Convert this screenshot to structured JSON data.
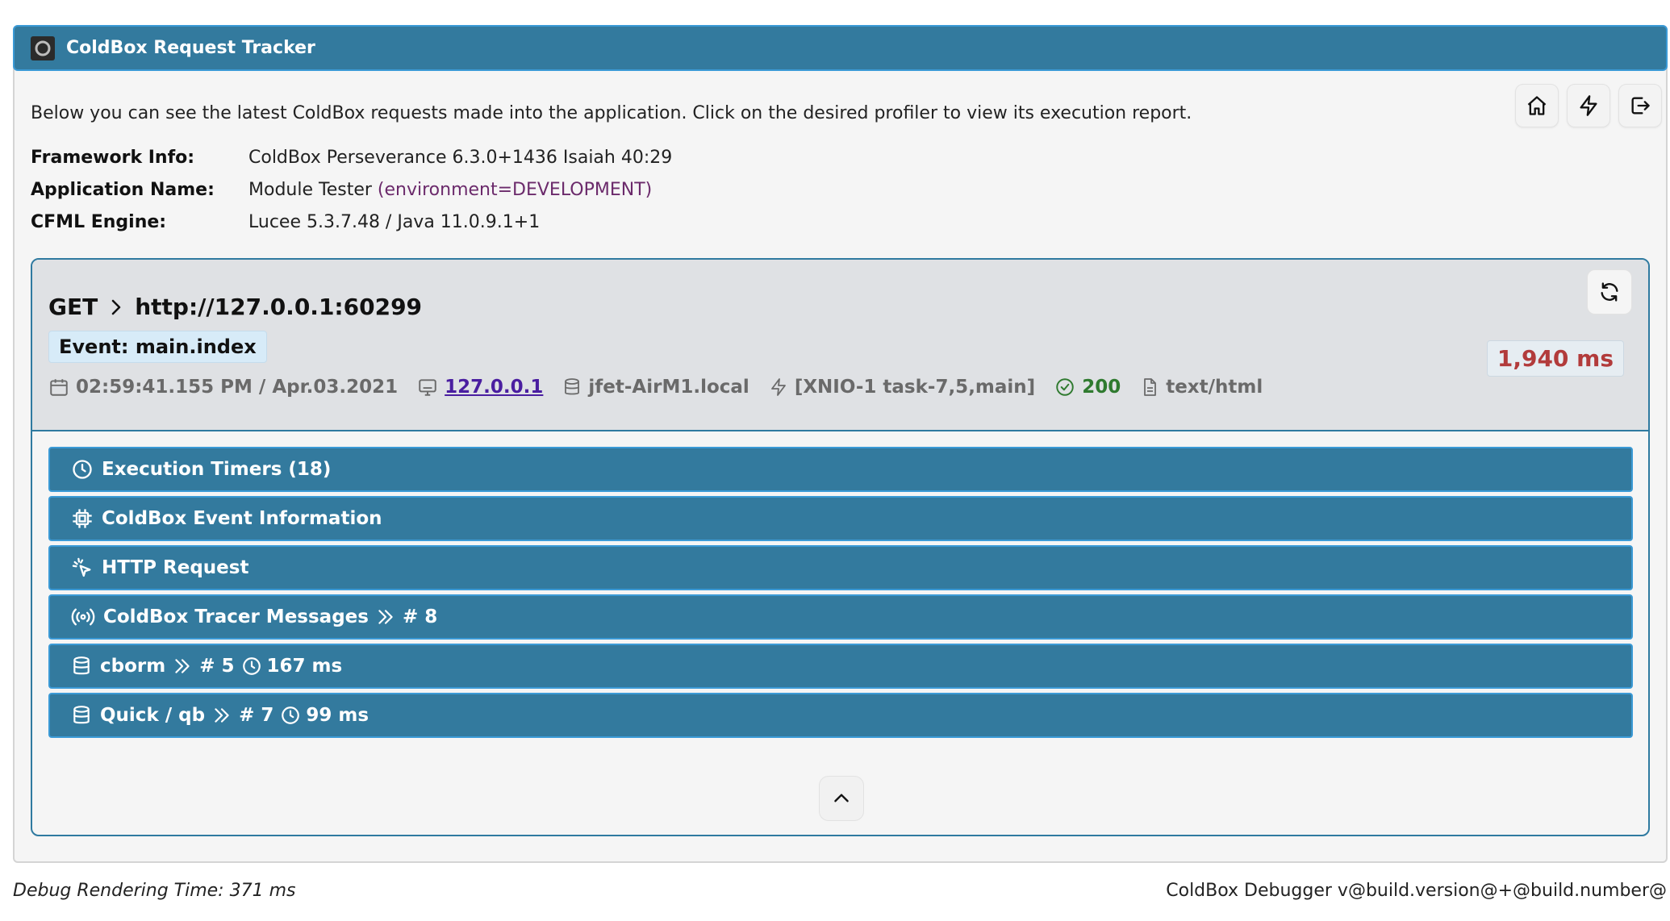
{
  "header": {
    "title": "ColdBox Request Tracker"
  },
  "intro": "Below you can see the latest ColdBox requests made into the application. Click on the desired profiler to view its execution report.",
  "info": [
    {
      "label": "Framework Info:",
      "value": "ColdBox Perseverance 6.3.0+1436 Isaiah 40:29",
      "extra": ""
    },
    {
      "label": "Application Name:",
      "value": "Module Tester",
      "extra": "(environment=DEVELOPMENT)"
    },
    {
      "label": "CFML Engine:",
      "value": "Lucee 5.3.7.48 / Java 11.0.9.1+1",
      "extra": ""
    }
  ],
  "request": {
    "method": "GET",
    "url": "http://127.0.0.1:60299",
    "event": "Event: main.index",
    "duration": "1,940 ms",
    "timestamp": "02:59:41.155 PM / Apr.03.2021",
    "ip": "127.0.0.1",
    "host": "jfet-AirM1.local",
    "thread": "[XNIO-1 task-7,5,main]",
    "status": "200",
    "content_type": "text/html"
  },
  "sections": [
    {
      "label": "Execution Timers (18)"
    },
    {
      "label": "ColdBox Event Information"
    },
    {
      "label": "HTTP Request"
    },
    {
      "label": "ColdBox Tracer Messages",
      "count": "# 8"
    },
    {
      "label": "cborm",
      "count": "# 5",
      "time": "167 ms"
    },
    {
      "label": "Quick / qb",
      "count": "# 7",
      "time": "99 ms"
    }
  ],
  "footer": {
    "left": "Debug Rendering Time: 371 ms",
    "right": "ColdBox Debugger v@build.version@+@build.number@"
  },
  "colors": {
    "header_bg": "#337a9e",
    "accent_border": "#3b9ad6",
    "duration": "#b23b3b",
    "status_ok": "#2f7a2f",
    "environment": "#6b2a6b"
  }
}
